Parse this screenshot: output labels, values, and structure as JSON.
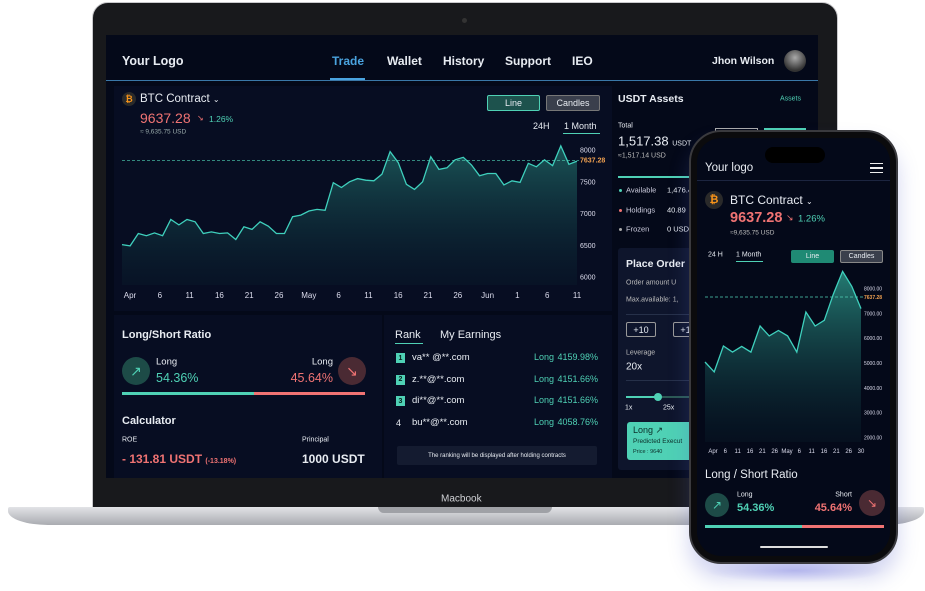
{
  "laptop": {
    "label": "Macbook"
  },
  "nav": {
    "logo": "Your Logo",
    "tabs": [
      "Trade",
      "Wallet",
      "History",
      "Support",
      "IEO"
    ],
    "active_tab": "Trade",
    "user": "Jhon Wilson"
  },
  "ticker": {
    "pair": "BTC Contract",
    "price": "9637.28",
    "change": "1.26%",
    "usd": "≈ 9,635.75 USD",
    "view_line": "Line",
    "view_candles": "Candles",
    "range_24h": "24H",
    "range_month": "1 Month"
  },
  "colors": {
    "accent": "#4fd1b5",
    "down": "#f07373",
    "nav_active": "#4aa3df",
    "background": "#040919"
  },
  "chart_data": [
    {
      "type": "area",
      "x_labels": [
        "Apr",
        "6",
        "11",
        "16",
        "21",
        "26",
        "May",
        "6",
        "11",
        "16",
        "21",
        "26",
        "Jun",
        "1",
        "6",
        "11"
      ],
      "y_ticks": [
        "8000",
        "7500",
        "7000",
        "6500",
        "6000"
      ],
      "ylim": [
        6000,
        8000
      ],
      "current_label": "7637.28",
      "current": 7837.28,
      "values": [
        6510,
        6490,
        6685,
        6650,
        6695,
        6650,
        6905,
        6820,
        6905,
        6870,
        6685,
        6710,
        6685,
        6695,
        6590,
        6790,
        6750,
        6870,
        6800,
        6685,
        6685,
        6950,
        6975,
        7040,
        7065,
        7050,
        7485,
        7410,
        7500,
        7550,
        7525,
        7515,
        7620,
        7975,
        7800,
        7460,
        7380,
        7500,
        7895,
        7695,
        7720,
        7845,
        7885,
        7765,
        7595,
        7630,
        7630,
        7450,
        7515,
        7490,
        7790,
        7735,
        7845,
        7755,
        8065,
        7775,
        7825
      ]
    },
    {
      "type": "area",
      "x_labels": [
        "Apr",
        "6",
        "11",
        "16",
        "21",
        "26",
        "May",
        "6",
        "11",
        "16",
        "21",
        "26",
        "30"
      ],
      "y_ticks": [
        "8000.00",
        "7000.00",
        "6000.00",
        "5000.00",
        "4000.00",
        "3000.00",
        "2000.00"
      ],
      "ylim": [
        2000,
        8000
      ],
      "current_label": "7637.28",
      "current": 7637.28,
      "values": [
        5020,
        4620,
        5665,
        5420,
        5650,
        5420,
        6470,
        6070,
        6290,
        6070,
        5420,
        7035,
        6470,
        6700,
        7770,
        8670,
        8065,
        7170
      ]
    }
  ],
  "ratio": {
    "title": "Long/Short Ratio",
    "long_label": "Long",
    "long_value": "54.36%",
    "short_label": "Long",
    "short_value": "45.64%",
    "long_fraction": 0.5436
  },
  "calculator": {
    "title": "Calculator",
    "roe_label": "ROE",
    "roe_value": "- 131.81 USDT",
    "roe_pct": "(-13.18%)",
    "principal_label": "Principal",
    "principal_value": "1000 USDT"
  },
  "rank": {
    "tab_rank": "Rank",
    "tab_earnings": "My Earnings",
    "rows": [
      {
        "pos": "1",
        "user": "va** @**.com",
        "side": "Long",
        "pct": "4159.98%"
      },
      {
        "pos": "2",
        "user": "z.**@**.com",
        "side": "Long",
        "pct": "4151.66%"
      },
      {
        "pos": "3",
        "user": "di**@**.com",
        "side": "Long",
        "pct": "4151.66%"
      },
      {
        "pos": "4",
        "user": "bu**@**.com",
        "side": "Long",
        "pct": "4058.76%"
      }
    ],
    "note": "The ranking will be displayed after holding contracts"
  },
  "assets": {
    "title": "USDT Assets",
    "link": "Assets",
    "total_label": "Total",
    "total": "1,517.38",
    "unit": "USDT",
    "total_usd": "≈1,517.14 USD",
    "rows": [
      {
        "label": "Available",
        "value": "1,476.4"
      },
      {
        "label": "Holdings",
        "value": "40.89"
      },
      {
        "label": "Frozen",
        "value": "0 USD"
      }
    ]
  },
  "order": {
    "title": "Place Order",
    "amount": "Order amount U",
    "max": "Max.available: 1,",
    "plus": "+10",
    "plus2": "+10",
    "leverage_label": "Leverage",
    "leverage": "20x",
    "slider_min": "1x",
    "slider_mid": "25x",
    "long": "Long",
    "predicted": "Predicted Execut",
    "price": "Price : 9640"
  },
  "mobile": {
    "logo": "Your logo",
    "pair": "BTC Contract",
    "price": "9637.28",
    "change": "1.26%",
    "usd": "≈9,635.75 USD",
    "range_24h": "24 H",
    "range_month": "1 Month",
    "view_line": "Line",
    "view_candles": "Candles",
    "ratio_title": "Long / Short Ratio",
    "long_label": "Long",
    "long_value": "54.36%",
    "short_label": "Short",
    "short_value": "45.64%"
  }
}
